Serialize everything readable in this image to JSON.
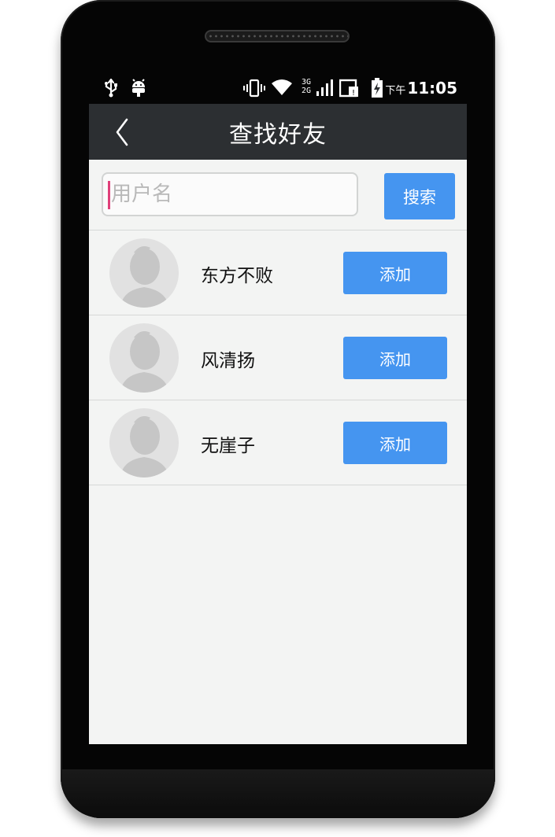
{
  "status_bar": {
    "ampm": "下午",
    "time": "11:05",
    "network_label_top": "3G",
    "network_label_bottom": "2G",
    "icons": [
      "usb-icon",
      "android-debug-icon",
      "vibrate-icon",
      "wifi-icon",
      "signal-icon",
      "sim-icon",
      "battery-charging-icon"
    ]
  },
  "header": {
    "title": "查找好友",
    "back_icon": "chevron-left-icon"
  },
  "search": {
    "placeholder": "用户名",
    "value": "",
    "button_label": "搜索"
  },
  "results": [
    {
      "name": "东方不败",
      "button_label": "添加"
    },
    {
      "name": "风清扬",
      "button_label": "添加"
    },
    {
      "name": "无崖子",
      "button_label": "添加"
    }
  ],
  "colors": {
    "accent": "#4595f0",
    "titlebar": "#2c2f32",
    "background": "#f3f4f3",
    "caret": "#e0407a"
  }
}
